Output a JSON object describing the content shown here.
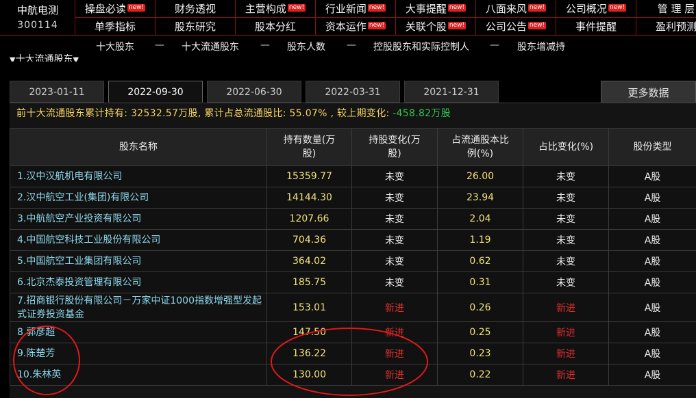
{
  "stock": {
    "name": "中航电测",
    "code": "300114"
  },
  "nav_row1": [
    {
      "label": "操盘必读",
      "badge": "new!"
    },
    {
      "label": "财务透视",
      "badge": ""
    },
    {
      "label": "主营构成",
      "badge": "new!"
    },
    {
      "label": "行业新闻",
      "badge": "new!"
    },
    {
      "label": "大事提醒",
      "badge": "new!"
    },
    {
      "label": "八面来风",
      "badge": "new!"
    },
    {
      "label": "公司概况",
      "badge": "new!"
    },
    {
      "label": "管 理 层",
      "badge": ""
    }
  ],
  "nav_row2": [
    {
      "label": "单季指标",
      "badge": ""
    },
    {
      "label": "股东研究",
      "badge": ""
    },
    {
      "label": "股本分红",
      "badge": ""
    },
    {
      "label": "资本运作",
      "badge": "new!"
    },
    {
      "label": "关联个股",
      "badge": "new!"
    },
    {
      "label": "公司公告",
      "badge": "new!"
    },
    {
      "label": "事件提醒",
      "badge": ""
    },
    {
      "label": "盈利预测",
      "badge": ""
    }
  ],
  "subnav": {
    "items": [
      "十大股东",
      "十大流通股东",
      "股东人数",
      "控股股东和实际控制人",
      "股东增减持"
    ],
    "separator": "—"
  },
  "section_title": "十大流通股东",
  "tabs": [
    "2023-01-11",
    "2022-09-30",
    "2022-06-30",
    "2022-03-31",
    "2021-12-31"
  ],
  "active_tab": "2022-09-30",
  "more_button": "更多数据",
  "summary": {
    "prefix": "前十大流通股东累计持有: 32532.57万股, 累计占总流通股比: 55.07% , 较上期变化:",
    "change": "-458.82万股"
  },
  "table": {
    "headers": [
      "股东名称",
      "持有数量(万股)",
      "持股变化(万股)",
      "占流通股本比例(%)",
      "占比变化(%)",
      "股份类型"
    ],
    "rows": [
      {
        "name": "1.汉中汉航机电有限公司",
        "qty": "15359.77",
        "change": "未变",
        "ratio": "26.00",
        "ratio_change": "未变",
        "type": "A股"
      },
      {
        "name": "2.汉中航空工业(集团)有限公司",
        "qty": "14144.30",
        "change": "未变",
        "ratio": "23.94",
        "ratio_change": "未变",
        "type": "A股"
      },
      {
        "name": "3.中航航空产业投资有限公司",
        "qty": "1207.66",
        "change": "未变",
        "ratio": "2.04",
        "ratio_change": "未变",
        "type": "A股"
      },
      {
        "name": "4.中国航空科技工业股份有限公司",
        "qty": "704.36",
        "change": "未变",
        "ratio": "1.19",
        "ratio_change": "未变",
        "type": "A股"
      },
      {
        "name": "5.中国航空工业集团有限公司",
        "qty": "364.02",
        "change": "未变",
        "ratio": "0.62",
        "ratio_change": "未变",
        "type": "A股"
      },
      {
        "name": "6.北京杰泰投资管理有限公司",
        "qty": "185.75",
        "change": "未变",
        "ratio": "0.31",
        "ratio_change": "未变",
        "type": "A股"
      },
      {
        "name": "7.招商银行股份有限公司－万家中证1000指数增强型发起式证券投资基金",
        "qty": "153.01",
        "change": "新进",
        "ratio": "0.26",
        "ratio_change": "新进",
        "type": "A股"
      },
      {
        "name": "8.郭彦超",
        "qty": "147.50",
        "change": "新进",
        "ratio": "0.25",
        "ratio_change": "新进",
        "type": "A股"
      },
      {
        "name": "9.陈楚芳",
        "qty": "136.22",
        "change": "新进",
        "ratio": "0.23",
        "ratio_change": "新进",
        "type": "A股"
      },
      {
        "name": "10.朱林英",
        "qty": "130.00",
        "change": "新进",
        "ratio": "0.22",
        "ratio_change": "新进",
        "type": "A股"
      }
    ]
  },
  "colors": {
    "grid_red": "#8a1010",
    "name_cyan": "#8fd8ec",
    "value_yellow": "#f2e27a",
    "new_red": "#e02d2d",
    "summary_yellow": "#f4d35e",
    "negative_green": "#35c24a",
    "annotation_red": "#e01818"
  }
}
